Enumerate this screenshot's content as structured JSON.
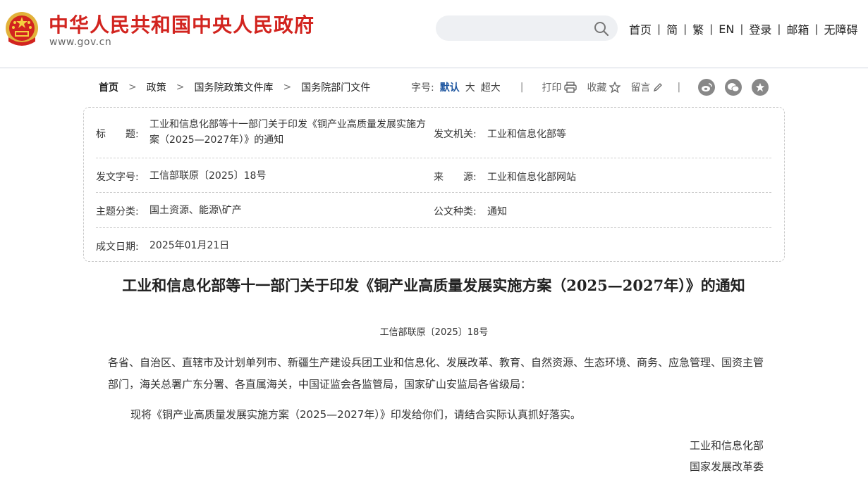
{
  "header": {
    "site_title": "中华人民共和国中央人民政府",
    "site_domain": "www.gov.cn",
    "search": {
      "placeholder": "",
      "value": ""
    },
    "nav": [
      "首页",
      "简",
      "繁",
      "EN",
      "登录",
      "邮箱",
      "无障碍"
    ],
    "nav_separator": "|"
  },
  "breadcrumb": {
    "items": [
      "首页",
      "政策",
      "国务院政策文件库",
      "国务院部门文件"
    ],
    "separator": ">"
  },
  "tools": {
    "font_size_label": "字号:",
    "font_options": [
      "默认",
      "大",
      "超大"
    ],
    "print_label": "打印",
    "favorite_label": "收藏",
    "comment_label": "留言",
    "separator": "|"
  },
  "info": {
    "title_label": "标　　题:",
    "title_value": "工业和信息化部等十一部门关于印发《铜产业高质量发展实施方案（2025—2027年）》的通知",
    "issuer_label": "发文机关:",
    "issuer_value": "工业和信息化部等",
    "doc_no_label": "发文字号:",
    "doc_no_value": "工信部联原〔2025〕18号",
    "source_label": "来　　源:",
    "source_value": "工业和信息化部网站",
    "topic_label": "主题分类:",
    "topic_value": "国土资源、能源\\矿产",
    "type_label": "公文种类:",
    "type_value": "通知",
    "date_label": "成文日期:",
    "date_value": "2025年01月21日"
  },
  "article": {
    "title": "工业和信息化部等十一部门关于印发《铜产业高质量发展实施方案（2025—2027年）》的通知",
    "doc_no": "工信部联原〔2025〕18号",
    "recipients": "各省、自治区、直辖市及计划单列市、新疆生产建设兵团工业和信息化、发展改革、教育、自然资源、生态环境、商务、应急管理、国资主管部门，海关总署广东分署、各直属海关，中国证监会各监管局，国家矿山安监局各省级局：",
    "body": "现将《铜产业高质量发展实施方案（2025—2027年）》印发给你们，请结合实际认真抓好落实。",
    "signatures": [
      "工业和信息化部",
      "国家发展改革委"
    ]
  },
  "colors": {
    "brand_red": "#d2241f",
    "accent_blue": "#1e56a0",
    "icon_gray": "#888888"
  }
}
